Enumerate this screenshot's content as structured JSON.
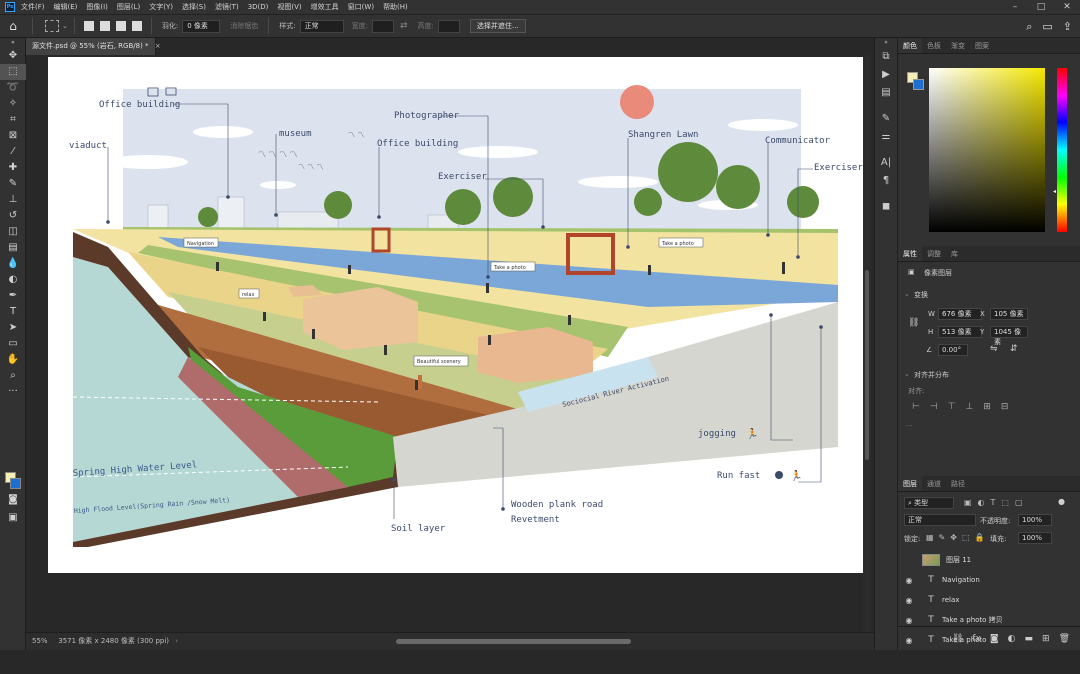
{
  "menubar": {
    "app_icon": "Ps",
    "items": [
      "文件(F)",
      "编辑(E)",
      "图像(I)",
      "图层(L)",
      "文字(Y)",
      "选择(S)",
      "滤镜(T)",
      "3D(D)",
      "视图(V)",
      "增效工具",
      "窗口(W)",
      "帮助(H)"
    ]
  },
  "options": {
    "feather_label": "羽化:",
    "feather_value": "0 像素",
    "antialias_label": "消除锯齿",
    "style_label": "样式:",
    "style_value": "正常",
    "width_label": "宽度:",
    "height_label": "高度:",
    "select_mask_button": "选择并遮住..."
  },
  "document": {
    "tab_title": "源文件.psd @ 55% (岩石, RGB/8) *",
    "zoom": "55%",
    "info": "3571 像素 x 2480 像素 (300 ppi)"
  },
  "artwork": {
    "labels": {
      "office_building_1": "Office building",
      "museum": "museum",
      "viaduct": "viaduct",
      "photographer": "Photographer",
      "office_building_2": "Office building",
      "shangren_lawn": "Shangren Lawn",
      "communicator": "Communicator",
      "exerciser_1": "Exerciser",
      "exerciser_2": "Exerciser",
      "navigation": "Navigation",
      "take_photo_1": "Take a photo",
      "take_photo_2": "Take a photo",
      "relax": "relax",
      "beautiful_scenery": "Beautiful scenery",
      "sociocial_river": "Sociocial River Activation",
      "jogging": "jogging",
      "run_fast": "Run fast",
      "spring_high_water": "Spring High Water Level",
      "high_flood": "High Flood Level(Spring Rain /Snow Melt)",
      "wooden_plank": "Wooden plank road",
      "revetment": "Revetment",
      "soil_layer": "Soil layer"
    }
  },
  "color_panel": {
    "tabs": [
      "颜色",
      "色板",
      "渐变",
      "图案"
    ],
    "fg_color": "#f6efb6",
    "bg_color": "#1d6fd0"
  },
  "properties_panel": {
    "tabs": [
      "属性",
      "调整",
      "库"
    ],
    "type_label": "像素图层",
    "transform_title": "变换",
    "w_label": "W",
    "w_value": "676 像素",
    "h_label": "H",
    "h_value": "513 像素",
    "x_label": "X",
    "x_value": "105 像素",
    "y_label": "Y",
    "y_value": "1045 像素",
    "angle_value": "0.00°",
    "align_title": "对齐并分布",
    "align_label": "对齐:"
  },
  "layers_panel": {
    "tabs": [
      "图层",
      "通道",
      "路径"
    ],
    "filter_value": "类型",
    "blend_mode": "正常",
    "opacity_label": "不透明度:",
    "opacity_value": "100%",
    "lock_label": "锁定:",
    "fill_label": "填充:",
    "fill_value": "100%",
    "layers": [
      {
        "name": "图层 11",
        "kind": "pixel",
        "visible": false
      },
      {
        "name": "Navigation",
        "kind": "text",
        "visible": true
      },
      {
        "name": "relax",
        "kind": "text",
        "visible": true
      },
      {
        "name": "Take a photo 拷贝",
        "kind": "text",
        "visible": true
      },
      {
        "name": "Take a photo",
        "kind": "text",
        "visible": true
      }
    ]
  }
}
